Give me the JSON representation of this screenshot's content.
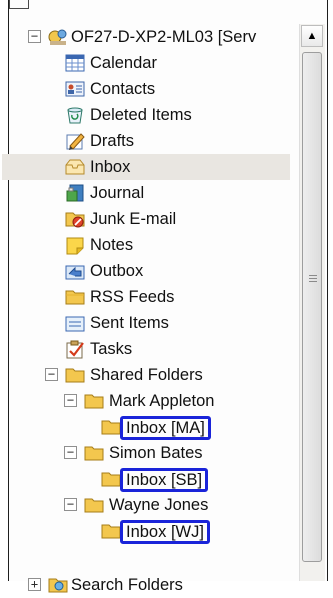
{
  "tree": {
    "root": {
      "label": "OF27-D-XP2-ML03 [Serv",
      "expander": "−"
    },
    "items": [
      {
        "label": "Calendar",
        "icon": "calendar-icon"
      },
      {
        "label": "Contacts",
        "icon": "contacts-icon"
      },
      {
        "label": "Deleted Items",
        "icon": "deleted-items-icon"
      },
      {
        "label": "Drafts",
        "icon": "drafts-icon"
      },
      {
        "label": "Inbox",
        "icon": "inbox-icon",
        "selected": true
      },
      {
        "label": "Journal",
        "icon": "journal-icon"
      },
      {
        "label": "Junk E-mail",
        "icon": "junk-email-icon"
      },
      {
        "label": "Notes",
        "icon": "notes-icon"
      },
      {
        "label": "Outbox",
        "icon": "outbox-icon"
      },
      {
        "label": "RSS Feeds",
        "icon": "rss-feeds-icon"
      },
      {
        "label": "Sent Items",
        "icon": "sent-items-icon"
      },
      {
        "label": "Tasks",
        "icon": "tasks-icon"
      }
    ],
    "shared": {
      "label": "Shared Folders",
      "expander": "−",
      "users": [
        {
          "label": "Mark Appleton",
          "expander": "−",
          "inbox": "Inbox [MA]"
        },
        {
          "label": "Simon Bates",
          "expander": "−",
          "inbox": "Inbox [SB]"
        },
        {
          "label": "Wayne Jones",
          "expander": "−",
          "inbox": "Inbox [WJ]"
        }
      ]
    },
    "search": {
      "label": "Search Folders",
      "expander": "+"
    }
  },
  "scrollbar": {
    "up": "▲"
  },
  "colors": {
    "highlight_border": "#1a24d9",
    "selected_bg": "#e9e6e1",
    "folder": "#f3c74e"
  }
}
